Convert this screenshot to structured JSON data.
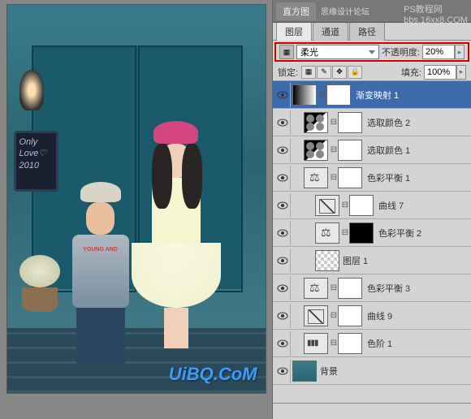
{
  "header": {
    "tab_histogram": "直方图",
    "subtitle": "思缘设计论坛",
    "badge1": "PS教程网",
    "badge2": "bbs.16xx8.COM"
  },
  "tabs": {
    "layers": "图层",
    "channels": "通道",
    "paths": "路径"
  },
  "blend": {
    "mode": "柔光",
    "opacity_label": "不透明度:",
    "opacity_value": "20%"
  },
  "lock": {
    "label": "锁定:",
    "fill_label": "填充:",
    "fill_value": "100%"
  },
  "layers_list": [
    {
      "name": "渐变映射 1",
      "type": "grad",
      "mask": "reveal",
      "selected": true,
      "indent": 0,
      "adj": true
    },
    {
      "name": "选取颜色 2",
      "type": "sel",
      "mask": "reveal",
      "indent": 1,
      "adj": true
    },
    {
      "name": "选取颜色 1",
      "type": "sel",
      "mask": "reveal",
      "indent": 1,
      "adj": true
    },
    {
      "name": "色彩平衡 1",
      "type": "bal",
      "mask": "reveal",
      "indent": 1,
      "adj": true
    },
    {
      "name": "曲线 7",
      "type": "curve",
      "mask": "reveal",
      "indent": 2,
      "adj": true
    },
    {
      "name": "色彩平衡 2",
      "type": "bal",
      "mask": "dark",
      "indent": 2,
      "adj": true
    },
    {
      "name": "图层 1",
      "type": "trans",
      "indent": 2
    },
    {
      "name": "色彩平衡 3",
      "type": "bal",
      "mask": "reveal",
      "indent": 1,
      "adj": true
    },
    {
      "name": "曲线 9",
      "type": "curve",
      "mask": "reveal",
      "indent": 1,
      "adj": true
    },
    {
      "name": "色阶 1",
      "type": "lvl",
      "mask": "reveal",
      "indent": 1,
      "adj": true
    },
    {
      "name": "背景",
      "type": "photo-t",
      "indent": 0
    }
  ],
  "chalkboard": {
    "line1": "Only",
    "line2": "Love♡",
    "line3": "2010"
  },
  "watermark": "UiBQ.CoM"
}
